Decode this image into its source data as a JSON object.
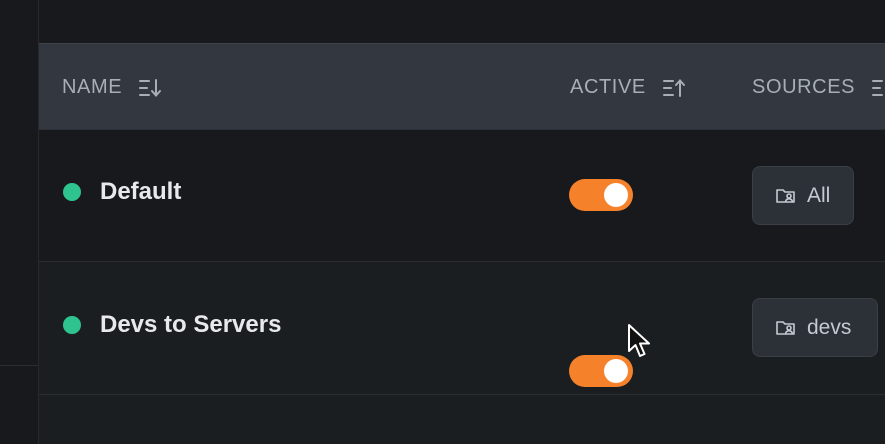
{
  "table": {
    "columns": [
      {
        "key": "name",
        "label": "NAME",
        "sort_icon": "sort-descending-icon"
      },
      {
        "key": "active",
        "label": "ACTIVE",
        "sort_icon": "sort-ascending-icon"
      },
      {
        "key": "sources",
        "label": "SOURCES",
        "sort_icon": "sort-icon"
      }
    ],
    "rows": [
      {
        "name": "Default",
        "status_color": "#2fc48f",
        "active": true,
        "source": "All",
        "source_icon": "folder-user-icon"
      },
      {
        "name": "Devs to Servers",
        "status_color": "#2fc48f",
        "active": true,
        "source": "devs",
        "source_icon": "folder-user-icon"
      }
    ]
  },
  "colors": {
    "background": "#17191c",
    "header_background": "#33373f",
    "status_active": "#2fc48f",
    "toggle_on": "#f5822a",
    "chip_background": "#2c3037"
  }
}
